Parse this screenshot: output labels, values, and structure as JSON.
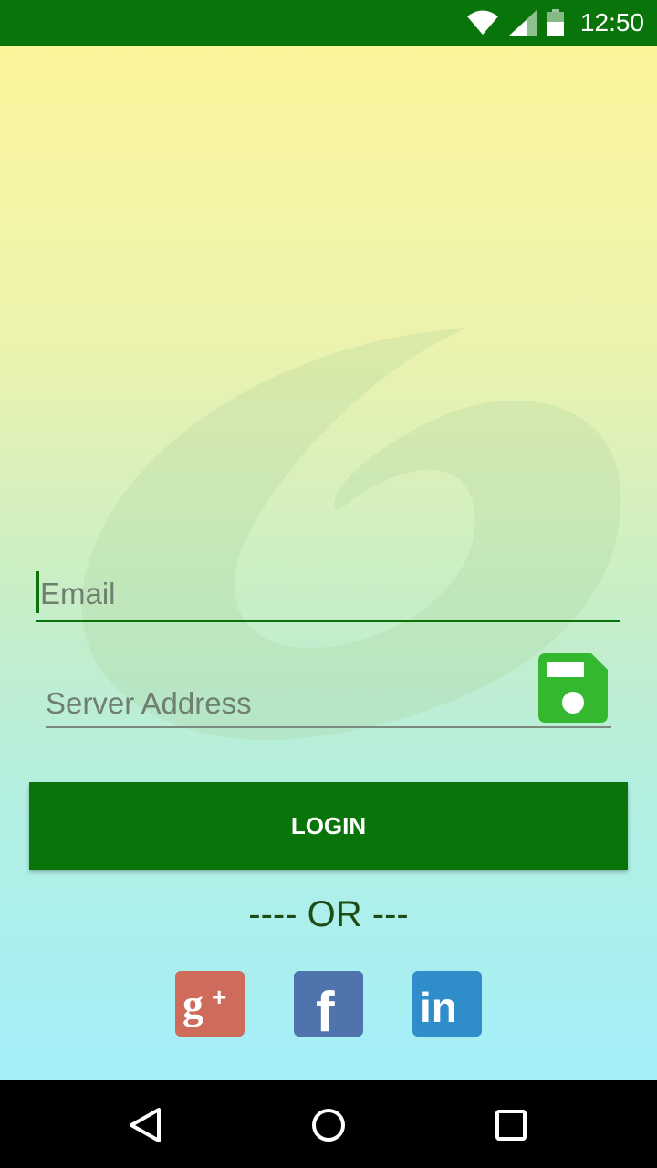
{
  "status_bar": {
    "time": "12:50",
    "icons": [
      "wifi-icon",
      "cell-signal-icon",
      "battery-icon"
    ],
    "background": "#08740a"
  },
  "login_form": {
    "email_placeholder": "Email",
    "email_value": "",
    "server_placeholder": "Server Address",
    "server_value": "",
    "save_icon": "floppy-disk-icon",
    "login_label": "LOGIN",
    "accent": "#08740a"
  },
  "social": {
    "divider": "---- OR ---",
    "providers": [
      {
        "name": "Google Plus",
        "icon": "google-plus-icon",
        "color": "#cf6b5a"
      },
      {
        "name": "Facebook",
        "icon": "facebook-icon",
        "color": "#4f73ad"
      },
      {
        "name": "LinkedIn",
        "icon": "linkedin-icon",
        "color": "#2f8dc9"
      }
    ]
  },
  "nav_bar": {
    "buttons": [
      "back-icon",
      "home-icon",
      "recent-apps-icon"
    ]
  }
}
